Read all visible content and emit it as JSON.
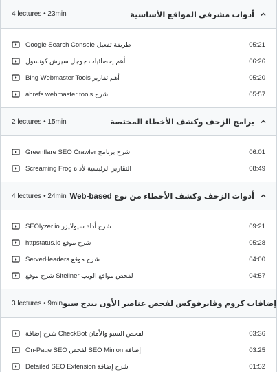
{
  "sections": [
    {
      "title": "أدوات مشرفي المواقع الأساسية",
      "meta": "4 lectures • 23min",
      "lectures": [
        {
          "title": "طريقة تفعيل Google Search Console",
          "duration": "05:21"
        },
        {
          "title": "أهم إحصائيات جوجل سيرش كونسول",
          "duration": "06:26"
        },
        {
          "title": "أهم تقارير Bing Webmaster Tools",
          "duration": "05:20"
        },
        {
          "title": "شرح ahrefs webmaster tools",
          "duration": "05:57"
        }
      ]
    },
    {
      "title": "برامج الزحف وكشف الأخطاء المختصة",
      "meta": "2 lectures • 15min",
      "lectures": [
        {
          "title": "شرح برنامج Greenflare SEO Crawler",
          "duration": "06:01"
        },
        {
          "title": "التقارير الرئيسية لأداة Screaming Frog",
          "duration": "08:49"
        }
      ]
    },
    {
      "title": "أدوات الزحف وكشف الأخطاء من نوع Web-based",
      "meta": "4 lectures • 24min",
      "lectures": [
        {
          "title": "شرح أداة سيولايزر SEOlyzer.io",
          "duration": "09:21"
        },
        {
          "title": "شرح موقع httpstatus.io",
          "duration": "05:28"
        },
        {
          "title": "شرح موقع ServerHeaders",
          "duration": "04:00"
        },
        {
          "title": "لفحص مواقع الويب Siteliner شرح موقع",
          "duration": "04:57"
        }
      ]
    },
    {
      "title": "إضافات كروم وفايرفوكس لفحص عناصر الأون بيدج سيو",
      "meta": "3 lectures • 9min",
      "lectures": [
        {
          "title": "لفحص السيو والأمان CheckBot شرح إضافة",
          "duration": "03:36"
        },
        {
          "title": "إضافة SEO Minion لفحص On-Page SEO",
          "duration": "03:25"
        },
        {
          "title": "شرح إضافة Detailed SEO Extension",
          "duration": "01:52"
        }
      ]
    }
  ],
  "icons": {
    "lecture": "video-play-icon",
    "section_toggle": "chevron-up-icon"
  }
}
